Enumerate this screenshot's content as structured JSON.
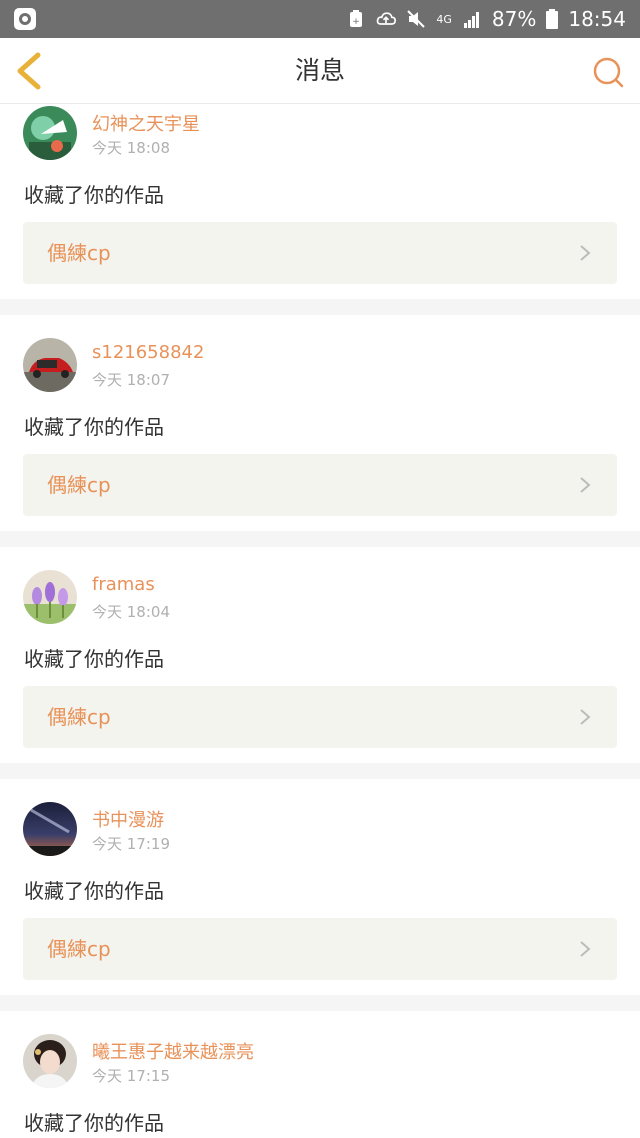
{
  "status_bar": {
    "battery": "87%",
    "time": "18:54",
    "network": "4G",
    "icons": [
      "app-icon",
      "battery-saver-icon",
      "cloud-upload-icon",
      "mute-icon",
      "network-4g-icon",
      "signal-icon",
      "battery-icon"
    ]
  },
  "nav": {
    "title": "消息",
    "back_icon": "chevron-left-icon",
    "search_icon": "search-icon"
  },
  "colors": {
    "accent": "#e8925a",
    "back_icon": "#e8b23a",
    "link_bg": "#f4f4ee",
    "status_bg": "#6f6f6f"
  },
  "messages": [
    {
      "user": "幻神之天宇星",
      "time": "今天 18:08",
      "action": "收藏了你的作品",
      "work": "偶練cp"
    },
    {
      "user": "s121658842",
      "time": "今天 18:07",
      "action": "收藏了你的作品",
      "work": "偶練cp"
    },
    {
      "user": "framas",
      "time": "今天 18:04",
      "action": "收藏了你的作品",
      "work": "偶練cp"
    },
    {
      "user": "书中漫游",
      "time": "今天 17:19",
      "action": "收藏了你的作品",
      "work": "偶練cp"
    },
    {
      "user": "曦王惠子越来越漂亮",
      "time": "今天 17:15",
      "action": "收藏了你的作品"
    }
  ]
}
